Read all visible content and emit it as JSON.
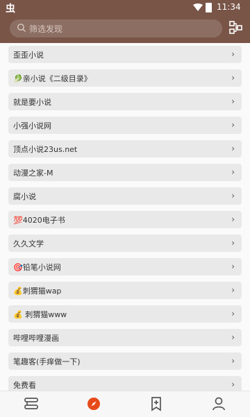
{
  "status": {
    "time": "11:34",
    "app_glyph": "虫"
  },
  "search": {
    "placeholder": "筛选发现"
  },
  "sources": [
    {
      "label": "歪歪小说"
    },
    {
      "label": "🥬亲小说《二级目录》"
    },
    {
      "label": "就是要小说"
    },
    {
      "label": "小强小说网"
    },
    {
      "label": "顶点小说23us.net"
    },
    {
      "label": "动漫之家-M"
    },
    {
      "label": "腐小说"
    },
    {
      "label": "💯4020电子书"
    },
    {
      "label": "久久文学"
    },
    {
      "label": "🎯铅笔小说网"
    },
    {
      "label": "💰刺猬猫wap"
    },
    {
      "label": "💰 刺猬猫www"
    },
    {
      "label": "哔哩哔哩漫画"
    },
    {
      "label": "笔趣客(手痒做一下)"
    },
    {
      "label": "免费看"
    }
  ],
  "chevron": "›",
  "colors": {
    "toolbar": "#795548",
    "accent": "#e64a19"
  },
  "bottom_nav": [
    "bookshelf-icon",
    "discover-icon",
    "bookmark-add-icon",
    "profile-icon"
  ]
}
